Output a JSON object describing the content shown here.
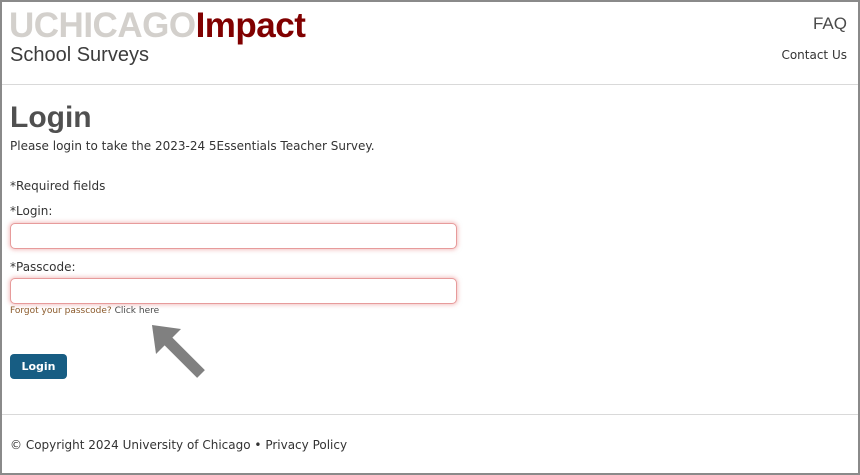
{
  "header": {
    "logo_part1": "UCHICAGO",
    "logo_part2": "Impact",
    "subtitle": "School Surveys",
    "faq_label": "FAQ",
    "contact_label": "Contact Us"
  },
  "main": {
    "title": "Login",
    "intro": "Please login to take the 2023-24 5Essentials Teacher Survey.",
    "required_note": "*Required fields",
    "login_label": "*Login:",
    "login_value": "",
    "passcode_label": "*Passcode:",
    "passcode_value": "",
    "forgot_text": "Forgot your passcode?",
    "forgot_link": "Click here",
    "login_button": "Login"
  },
  "footer": {
    "copyright": "© Copyright 2024 University of Chicago",
    "separator": "•",
    "privacy_link": "Privacy Policy"
  },
  "colors": {
    "brand_maroon": "#800000",
    "logo_gray": "#d3d0cc",
    "button_blue": "#175d83",
    "arrow_gray": "#808080",
    "input_border": "#e79b9b"
  },
  "icons": {
    "annotation_arrow": "arrow-pointer-icon"
  }
}
